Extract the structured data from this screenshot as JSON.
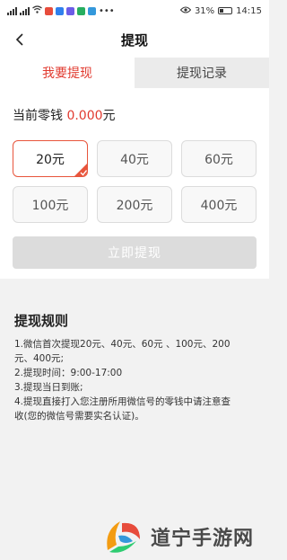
{
  "status_bar": {
    "battery_percent": "31%",
    "time": "14:15"
  },
  "header": {
    "title": "提现"
  },
  "tabs": [
    {
      "label": "我要提现",
      "active": true
    },
    {
      "label": "提现记录",
      "active": false
    }
  ],
  "balance": {
    "label": "当前零钱",
    "value": "0.000",
    "unit": "元"
  },
  "amounts": [
    {
      "label": "20元",
      "selected": true
    },
    {
      "label": "40元",
      "selected": false
    },
    {
      "label": "60元",
      "selected": false
    },
    {
      "label": "100元",
      "selected": false
    },
    {
      "label": "200元",
      "selected": false
    },
    {
      "label": "400元",
      "selected": false
    }
  ],
  "withdraw_button": {
    "label": "立即提现",
    "enabled": false
  },
  "rules": {
    "title": "提现规则",
    "lines": [
      "1.微信首次提现20元、40元、60元 、100元、200",
      "元、400元;",
      "2.提现时间：9:00-17:00",
      "3.提现当日到账;",
      "4.提现直接打入您注册所用微信号的零钱中请注意查",
      "收(您的微信号需要实名认证)。"
    ]
  },
  "watermark": {
    "text": "道宁手游网"
  },
  "colors": {
    "accent": "#e13a2f",
    "selected_border": "#e8553c",
    "disabled_button": "#dcdcdc",
    "page_background": "#f2f2f2"
  }
}
